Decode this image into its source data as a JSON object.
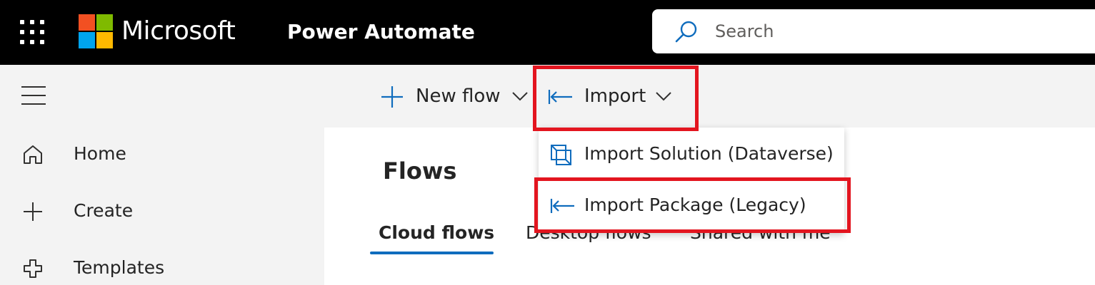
{
  "header": {
    "brand": "Microsoft",
    "app_name": "Power Automate",
    "search_placeholder": "Search"
  },
  "nav": {
    "items": [
      {
        "label": "Home",
        "icon": "home-icon"
      },
      {
        "label": "Create",
        "icon": "plus-icon"
      },
      {
        "label": "Templates",
        "icon": "templates-icon"
      }
    ]
  },
  "toolbar": {
    "new_flow_label": "New flow",
    "import_label": "Import"
  },
  "import_menu": {
    "items": [
      {
        "label": "Import Solution (Dataverse)",
        "icon": "solution-icon"
      },
      {
        "label": "Import Package (Legacy)",
        "icon": "import-arrow-icon"
      }
    ]
  },
  "page": {
    "title": "Flows",
    "tabs": [
      {
        "label": "Cloud flows",
        "active": true
      },
      {
        "label": "Desktop flows",
        "active": false
      },
      {
        "label": "Shared with me",
        "active": false
      }
    ]
  },
  "colors": {
    "accent": "#0f6cbd",
    "highlight": "#e3151f",
    "header_bg": "#000000",
    "ms_red": "#f25022",
    "ms_green": "#7fba00",
    "ms_blue": "#00a4ef",
    "ms_yellow": "#ffb900"
  }
}
